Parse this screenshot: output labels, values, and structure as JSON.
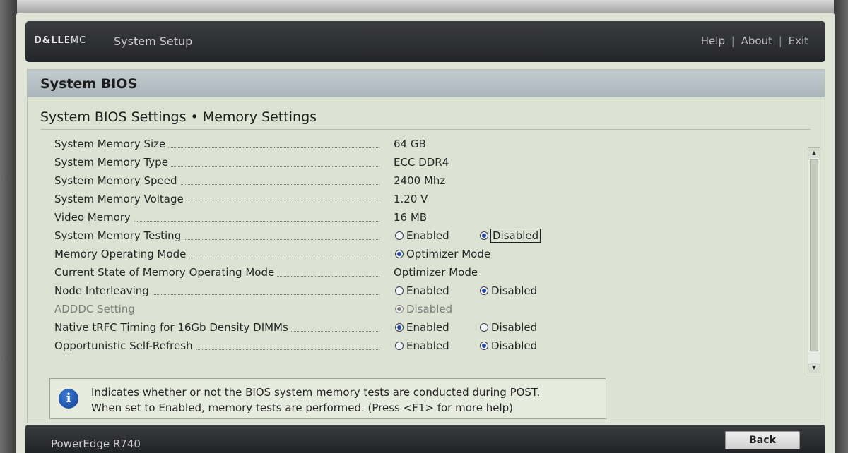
{
  "header": {
    "logo_brand": "D&LL",
    "logo_suffix": "EMC",
    "app_title": "System Setup",
    "links": {
      "help": "Help",
      "about": "About",
      "exit": "Exit",
      "separator": "|"
    }
  },
  "panel": {
    "title": "System BIOS",
    "subtitle": "System BIOS Settings • Memory Settings"
  },
  "settings": [
    {
      "label": "System Memory Size",
      "value": "64 GB"
    },
    {
      "label": "System Memory Type",
      "value": "ECC DDR4"
    },
    {
      "label": "System Memory Speed",
      "value": "2400 Mhz"
    },
    {
      "label": "System Memory Voltage",
      "value": "1.20 V"
    },
    {
      "label": "Video Memory",
      "value": "16 MB"
    },
    {
      "label": "System Memory Testing",
      "options": [
        "Enabled",
        "Disabled"
      ],
      "selected": "Disabled"
    },
    {
      "label": "Memory Operating Mode",
      "options": [
        "Optimizer Mode"
      ],
      "selected": "Optimizer Mode"
    },
    {
      "label": "Current State of Memory Operating Mode",
      "value": "Optimizer Mode"
    },
    {
      "label": "Node Interleaving",
      "options": [
        "Enabled",
        "Disabled"
      ],
      "selected": "Disabled"
    },
    {
      "label": "ADDDC Setting",
      "options": [
        "Disabled"
      ],
      "selected": "Disabled",
      "disabled": true
    },
    {
      "label": "Native tRFC Timing for 16Gb Density DIMMs",
      "options": [
        "Enabled",
        "Disabled"
      ],
      "selected": "Enabled"
    },
    {
      "label": "Opportunistic Self-Refresh",
      "options": [
        "Enabled",
        "Disabled"
      ],
      "selected": "Disabled"
    }
  ],
  "help": {
    "icon": "info-icon",
    "line1": "Indicates whether or not the BIOS system memory tests are conducted during POST.",
    "line2": "When set to Enabled, memory tests are performed. (Press <F1> for more help)"
  },
  "footer": {
    "model": "PowerEdge R740",
    "back_label": "Back"
  },
  "colors": {
    "header_bg": "#2e2f32",
    "panel_bg": "#dde3d3",
    "panel_head_bg": "#b6c0c5",
    "radio_selected": "#2349a8"
  }
}
